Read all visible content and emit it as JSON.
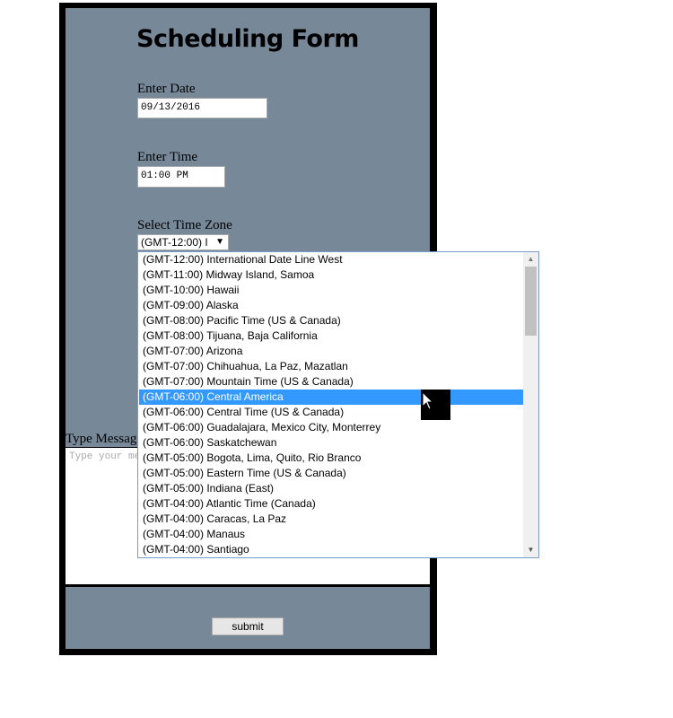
{
  "form": {
    "title": "Scheduling Form",
    "date_label": "Enter Date",
    "date_value": "09/13/2016",
    "time_label": "Enter Time",
    "time_value": "01:00 PM",
    "timezone_label": "Select Time Zone",
    "timezone_selected": "(GMT-12:00) I",
    "message_label": "Type Message",
    "message_placeholder": "Type your message",
    "submit_label": "submit"
  },
  "timezone_dropdown": {
    "options": [
      "(GMT-12:00) International Date Line West",
      "(GMT-11:00) Midway Island, Samoa",
      "(GMT-10:00) Hawaii",
      "(GMT-09:00) Alaska",
      "(GMT-08:00) Pacific Time (US & Canada)",
      "(GMT-08:00) Tijuana, Baja California",
      "(GMT-07:00) Arizona",
      "(GMT-07:00) Chihuahua, La Paz, Mazatlan",
      "(GMT-07:00) Mountain Time (US & Canada)",
      "(GMT-06:00) Central America",
      "(GMT-06:00) Central Time (US & Canada)",
      "(GMT-06:00) Guadalajara, Mexico City, Monterrey",
      "(GMT-06:00) Saskatchewan",
      "(GMT-05:00) Bogota, Lima, Quito, Rio Branco",
      "(GMT-05:00) Eastern Time (US & Canada)",
      "(GMT-05:00) Indiana (East)",
      "(GMT-04:00) Atlantic Time (Canada)",
      "(GMT-04:00) Caracas, La Paz",
      "(GMT-04:00) Manaus",
      "(GMT-04:00) Santiago"
    ],
    "highlighted_index": 9
  },
  "colors": {
    "panel": "#778899",
    "highlight": "#3399ff"
  },
  "icons": {
    "dropdown": "chevron-down-icon",
    "cursor": "mouse-pointer-icon"
  }
}
